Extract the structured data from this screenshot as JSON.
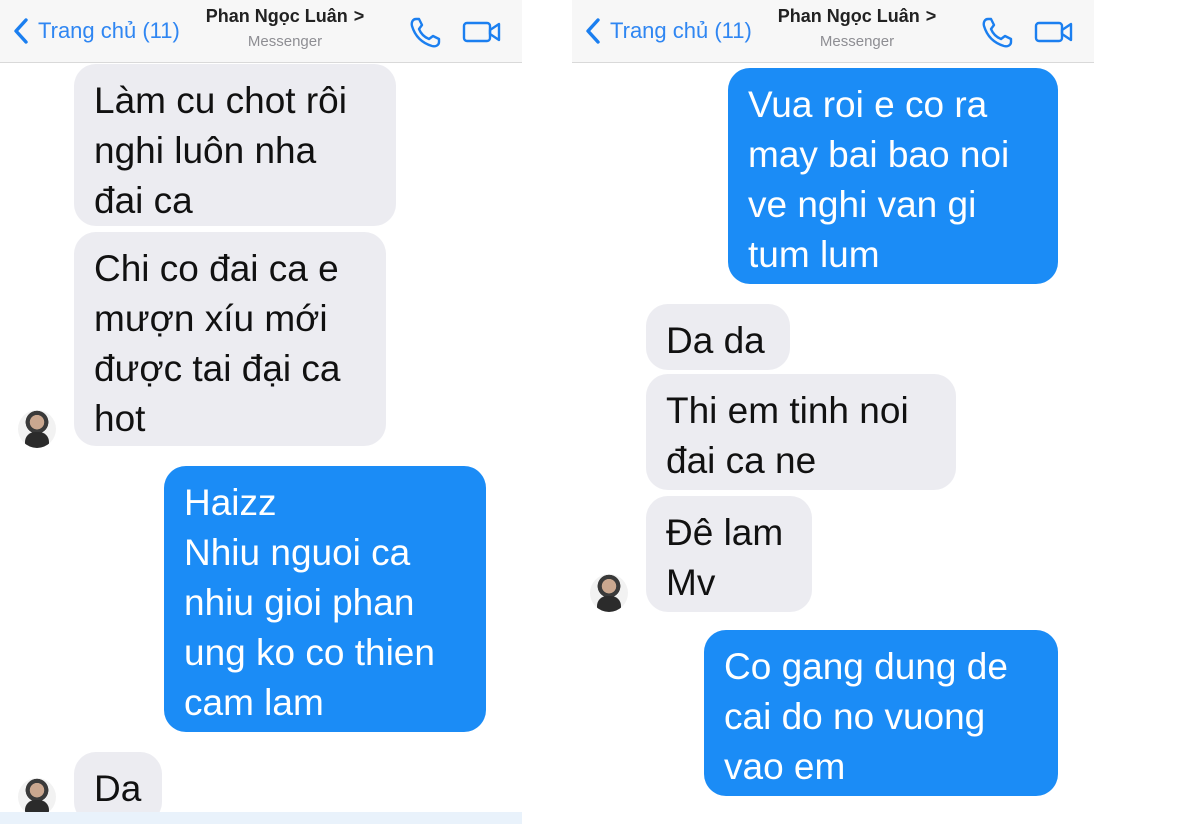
{
  "left": {
    "header": {
      "back_label": "Trang chủ (11)",
      "contact_name": "Phan Ngọc Luân",
      "chevron": ">",
      "subtitle": "Messenger"
    },
    "messages": [
      {
        "dir": "in",
        "text": "Làm cu chot rôi\nnghi luôn nha\nđai ca"
      },
      {
        "dir": "in",
        "text": "Chi co đai ca e\nmượn xíu mới\nđược tai đại ca\nhot"
      },
      {
        "dir": "out",
        "text": "Haizz\nNhiu nguoi ca\nnhiu gioi phan\nung ko co thien\ncam lam"
      },
      {
        "dir": "in",
        "text": "Da"
      }
    ]
  },
  "right": {
    "header": {
      "back_label": "Trang chủ (11)",
      "contact_name": "Phan Ngọc Luân",
      "chevron": ">",
      "subtitle": "Messenger"
    },
    "messages": [
      {
        "dir": "out",
        "text": "Vua roi e co ra\nmay bai bao noi\nve nghi van gi\ntum lum"
      },
      {
        "dir": "in",
        "text": "Da da"
      },
      {
        "dir": "in",
        "text": "Thi em tinh noi\nđai ca ne"
      },
      {
        "dir": "in",
        "text": "Đê lam\nMv"
      },
      {
        "dir": "out",
        "text": "Co gang dung de\ncai do no vuong\nvao em"
      }
    ]
  },
  "colors": {
    "outgoing": "#1b8cf6",
    "incoming": "#ececf1",
    "accent": "#1b7ff0"
  },
  "icons": [
    "chevron-left-icon",
    "phone-icon",
    "video-camera-icon",
    "avatar"
  ]
}
